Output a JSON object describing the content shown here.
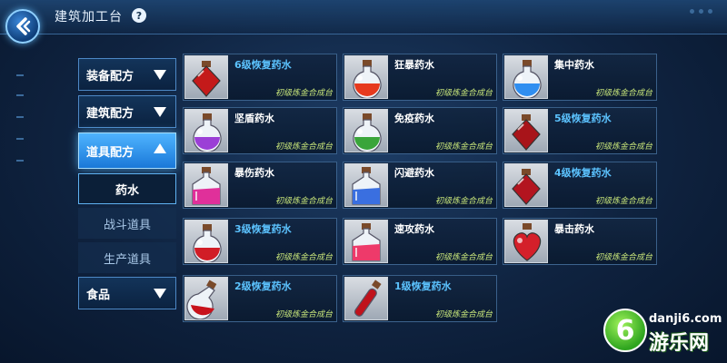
{
  "header": {
    "title": "建筑加工台",
    "help_icon": "?",
    "back_icon": "back-arrow-icon"
  },
  "sidebar": {
    "categories": [
      {
        "label": "装备配方",
        "expanded": false
      },
      {
        "label": "建筑配方",
        "expanded": false
      },
      {
        "label": "道具配方",
        "expanded": true
      },
      {
        "label": "食品",
        "expanded": false
      }
    ],
    "subcategories": [
      {
        "label": "药水",
        "selected": true
      },
      {
        "label": "战斗道具",
        "selected": false
      },
      {
        "label": "生产道具",
        "selected": false
      }
    ]
  },
  "items": [
    {
      "name": "6级恢复药水",
      "source": "初级炼金合成台",
      "name_color": "blue",
      "liquid": "#c41a1a",
      "bottle": "diamond"
    },
    {
      "name": "狂暴药水",
      "source": "初级炼金合成台",
      "name_color": "white",
      "liquid": "#e63a1e",
      "bottle": "round"
    },
    {
      "name": "集中药水",
      "source": "初级炼金合成台",
      "name_color": "white",
      "liquid": "#2f8ef0",
      "bottle": "round"
    },
    {
      "name": "坚盾药水",
      "source": "初级炼金合成台",
      "name_color": "white",
      "liquid": "#9b3fd6",
      "bottle": "round"
    },
    {
      "name": "免疫药水",
      "source": "初级炼金合成台",
      "name_color": "white",
      "liquid": "#3aa53a",
      "bottle": "round"
    },
    {
      "name": "5级恢复药水",
      "source": "初级炼金合成台",
      "name_color": "blue",
      "liquid": "#a8141a",
      "bottle": "diamond"
    },
    {
      "name": "暴伤药水",
      "source": "初级炼金合成台",
      "name_color": "white",
      "liquid": "#e0309a",
      "bottle": "square"
    },
    {
      "name": "闪避药水",
      "source": "初级炼金合成台",
      "name_color": "white",
      "liquid": "#3a6fe0",
      "bottle": "square"
    },
    {
      "name": "4级恢复药水",
      "source": "初级炼金合成台",
      "name_color": "blue",
      "liquid": "#b3141f",
      "bottle": "diamond"
    },
    {
      "name": "3级恢复药水",
      "source": "初级炼金合成台",
      "name_color": "blue",
      "liquid": "#d11d26",
      "bottle": "round"
    },
    {
      "name": "速攻药水",
      "source": "初级炼金合成台",
      "name_color": "white",
      "liquid": "#ee3a6a",
      "bottle": "square"
    },
    {
      "name": "暴击药水",
      "source": "初级炼金合成台",
      "name_color": "white",
      "liquid": "#d4202a",
      "bottle": "heart"
    },
    {
      "name": "2级恢复药水",
      "source": "初级炼金合成台",
      "name_color": "blue",
      "liquid": "#c8121c",
      "bottle": "flask"
    },
    {
      "name": "1级恢复药水",
      "source": "初级炼金合成台",
      "name_color": "blue",
      "liquid": "#c0121c",
      "bottle": "tube"
    }
  ],
  "watermark": {
    "logo_char": "6",
    "domain": "danji6.com",
    "brand": "游乐网"
  }
}
